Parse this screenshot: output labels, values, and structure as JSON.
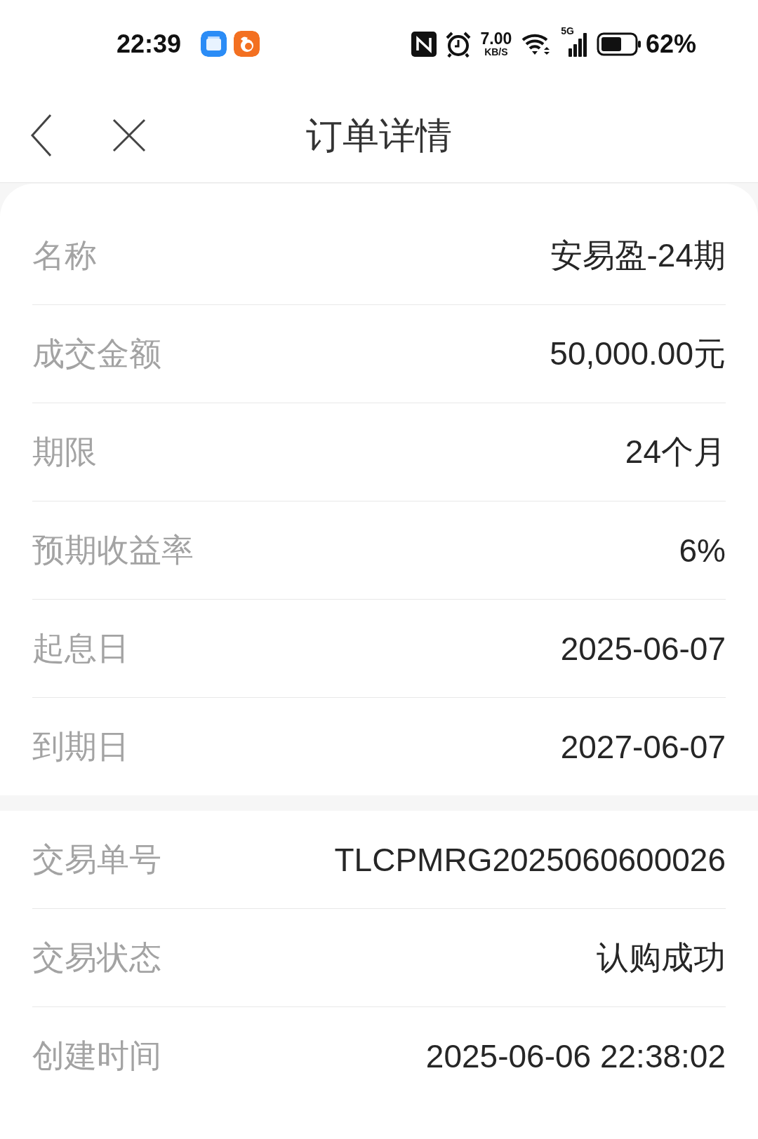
{
  "status_bar": {
    "time": "22:39",
    "net_speed": "7.00",
    "net_unit": "KB/S",
    "network": "5G",
    "battery": "62%"
  },
  "header": {
    "title": "订单详情"
  },
  "sections": [
    {
      "rows": [
        {
          "label": "名称",
          "value": "安易盈-24期"
        },
        {
          "label": "成交金额",
          "value": "50,000.00元"
        },
        {
          "label": "期限",
          "value": "24个月"
        },
        {
          "label": "预期收益率",
          "value": "6%"
        },
        {
          "label": "起息日",
          "value": "2025-06-07"
        },
        {
          "label": "到期日",
          "value": "2027-06-07"
        }
      ]
    },
    {
      "rows": [
        {
          "label": "交易单号",
          "value": "TLCPMRG2025060600026"
        },
        {
          "label": "交易状态",
          "value": "认购成功"
        },
        {
          "label": "创建时间",
          "value": "2025-06-06 22:38:02"
        }
      ]
    }
  ]
}
